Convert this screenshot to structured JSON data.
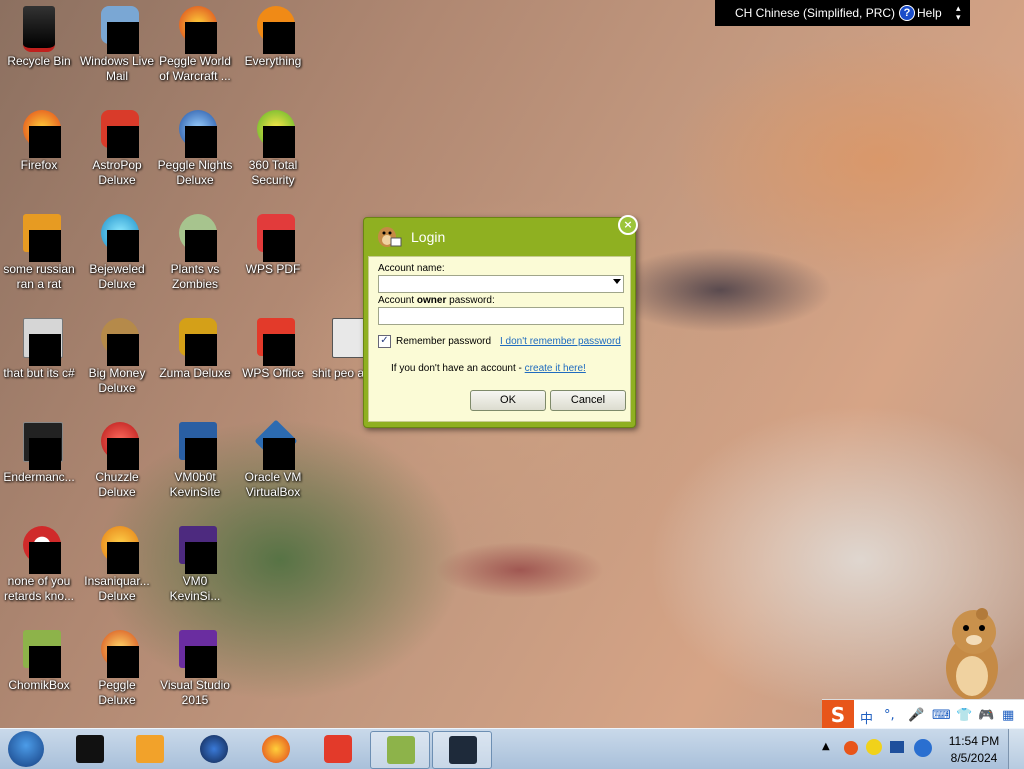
{
  "language_bar": {
    "language": "CH Chinese (Simplified, PRC)",
    "help_label": "Help"
  },
  "desktop_icons": [
    {
      "label": "Recycle Bin",
      "icon": "recycle-bin-icon"
    },
    {
      "label": "Windows Live Mail",
      "icon": "mail-icon"
    },
    {
      "label": "Peggle World of Warcraft ...",
      "icon": "peggle-icon"
    },
    {
      "label": "Everything",
      "icon": "search-icon"
    },
    {
      "label": "Firefox",
      "icon": "firefox-icon"
    },
    {
      "label": "AstroPop Deluxe",
      "icon": "game-icon"
    },
    {
      "label": "Peggle Nights Deluxe",
      "icon": "peggle-icon"
    },
    {
      "label": "360 Total Security",
      "icon": "shield-icon"
    },
    {
      "label": "some russian ran a rat",
      "icon": "shortcut-icon"
    },
    {
      "label": "Bejeweled Deluxe",
      "icon": "gem-icon"
    },
    {
      "label": "Plants vs Zombies",
      "icon": "game-icon"
    },
    {
      "label": "WPS PDF",
      "icon": "pdf-icon"
    },
    {
      "label": "that but its c#",
      "icon": "folder-icon"
    },
    {
      "label": "Big Money Deluxe",
      "icon": "money-icon"
    },
    {
      "label": "Zuma Deluxe",
      "icon": "game-icon"
    },
    {
      "label": "WPS Office",
      "icon": "office-icon"
    },
    {
      "label": "shit peo asked m",
      "icon": "file-icon"
    },
    {
      "label": "Endermanc...",
      "icon": "terminal-icon"
    },
    {
      "label": "Chuzzle Deluxe",
      "icon": "game-icon"
    },
    {
      "label": "VM0b0t KevinSite",
      "icon": "vm-icon"
    },
    {
      "label": "Oracle VM VirtualBox",
      "icon": "virtualbox-icon"
    },
    {
      "label": "none of you retards kno...",
      "icon": "shortcut-icon"
    },
    {
      "label": "Insaniquar... Deluxe",
      "icon": "fish-icon"
    },
    {
      "label": "VM0 KevinSi...",
      "icon": "vm-icon"
    },
    {
      "label": "ChomikBox",
      "icon": "chomikbox-icon"
    },
    {
      "label": "Peggle Deluxe",
      "icon": "peggle-icon"
    },
    {
      "label": "Visual Studio 2015",
      "icon": "visual-studio-icon"
    }
  ],
  "login_dialog": {
    "title": "Login",
    "account_name_label": "Account name:",
    "account_name_value": "",
    "password_label_pre": "Account ",
    "password_label_bold": "owner",
    "password_label_post": " password:",
    "password_value": "",
    "remember_label": "Remember password",
    "remember_checked": true,
    "forgot_link": "I don't remember password",
    "no_account_text": "If you don't have an account - ",
    "create_link": "create it here!",
    "ok_label": "OK",
    "cancel_label": "Cancel"
  },
  "ime_bar": {
    "mode": "中",
    "punct": "°,"
  },
  "taskbar": {
    "items": [
      "terminal-icon",
      "media-player-icon",
      "globe-icon",
      "firefox-icon",
      "wps-icon",
      "chomikbox-icon",
      "virtualbox-icon"
    ],
    "active_item": "chomikbox-icon"
  },
  "clock": {
    "time": "11:54 PM",
    "date": "8/5/2024"
  }
}
